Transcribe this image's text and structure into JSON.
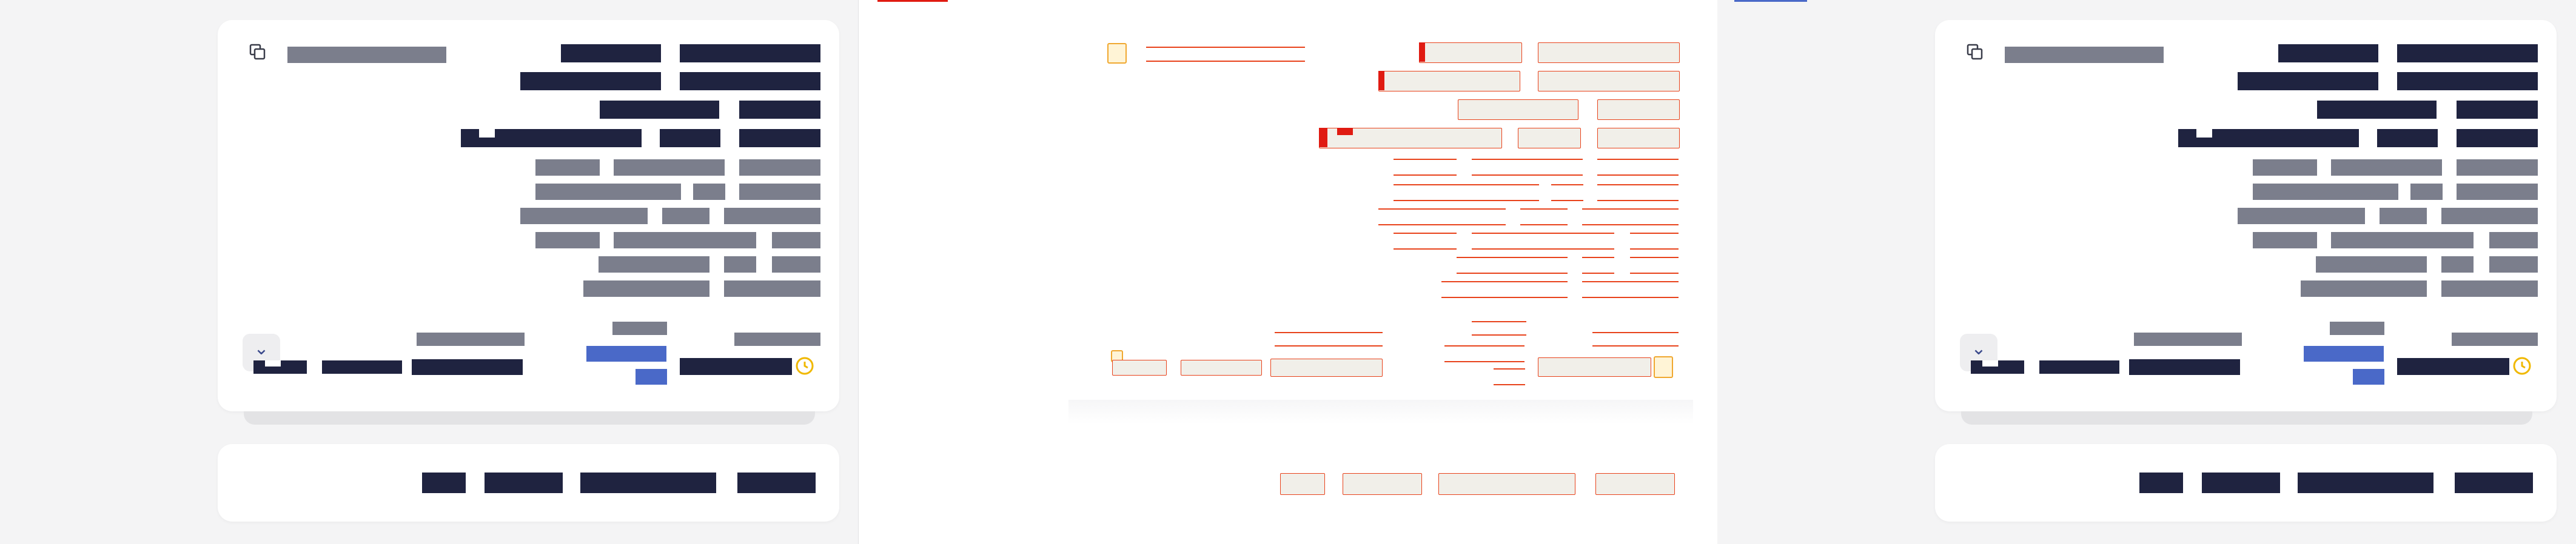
{
  "panels": {
    "left": {
      "label": ""
    },
    "middle": {
      "label": ""
    },
    "right": {
      "label": ""
    }
  },
  "colors": {
    "dark_text": "#1f2340",
    "muted_text": "#7b7e8c",
    "accent_blue": "#4a69c8",
    "wireframe_red": "#e8421b",
    "clock_yellow": "#f0b800"
  },
  "icons": {
    "copy": "copy-icon",
    "expand": "chevron-down-icon",
    "clock": "clock-icon"
  }
}
